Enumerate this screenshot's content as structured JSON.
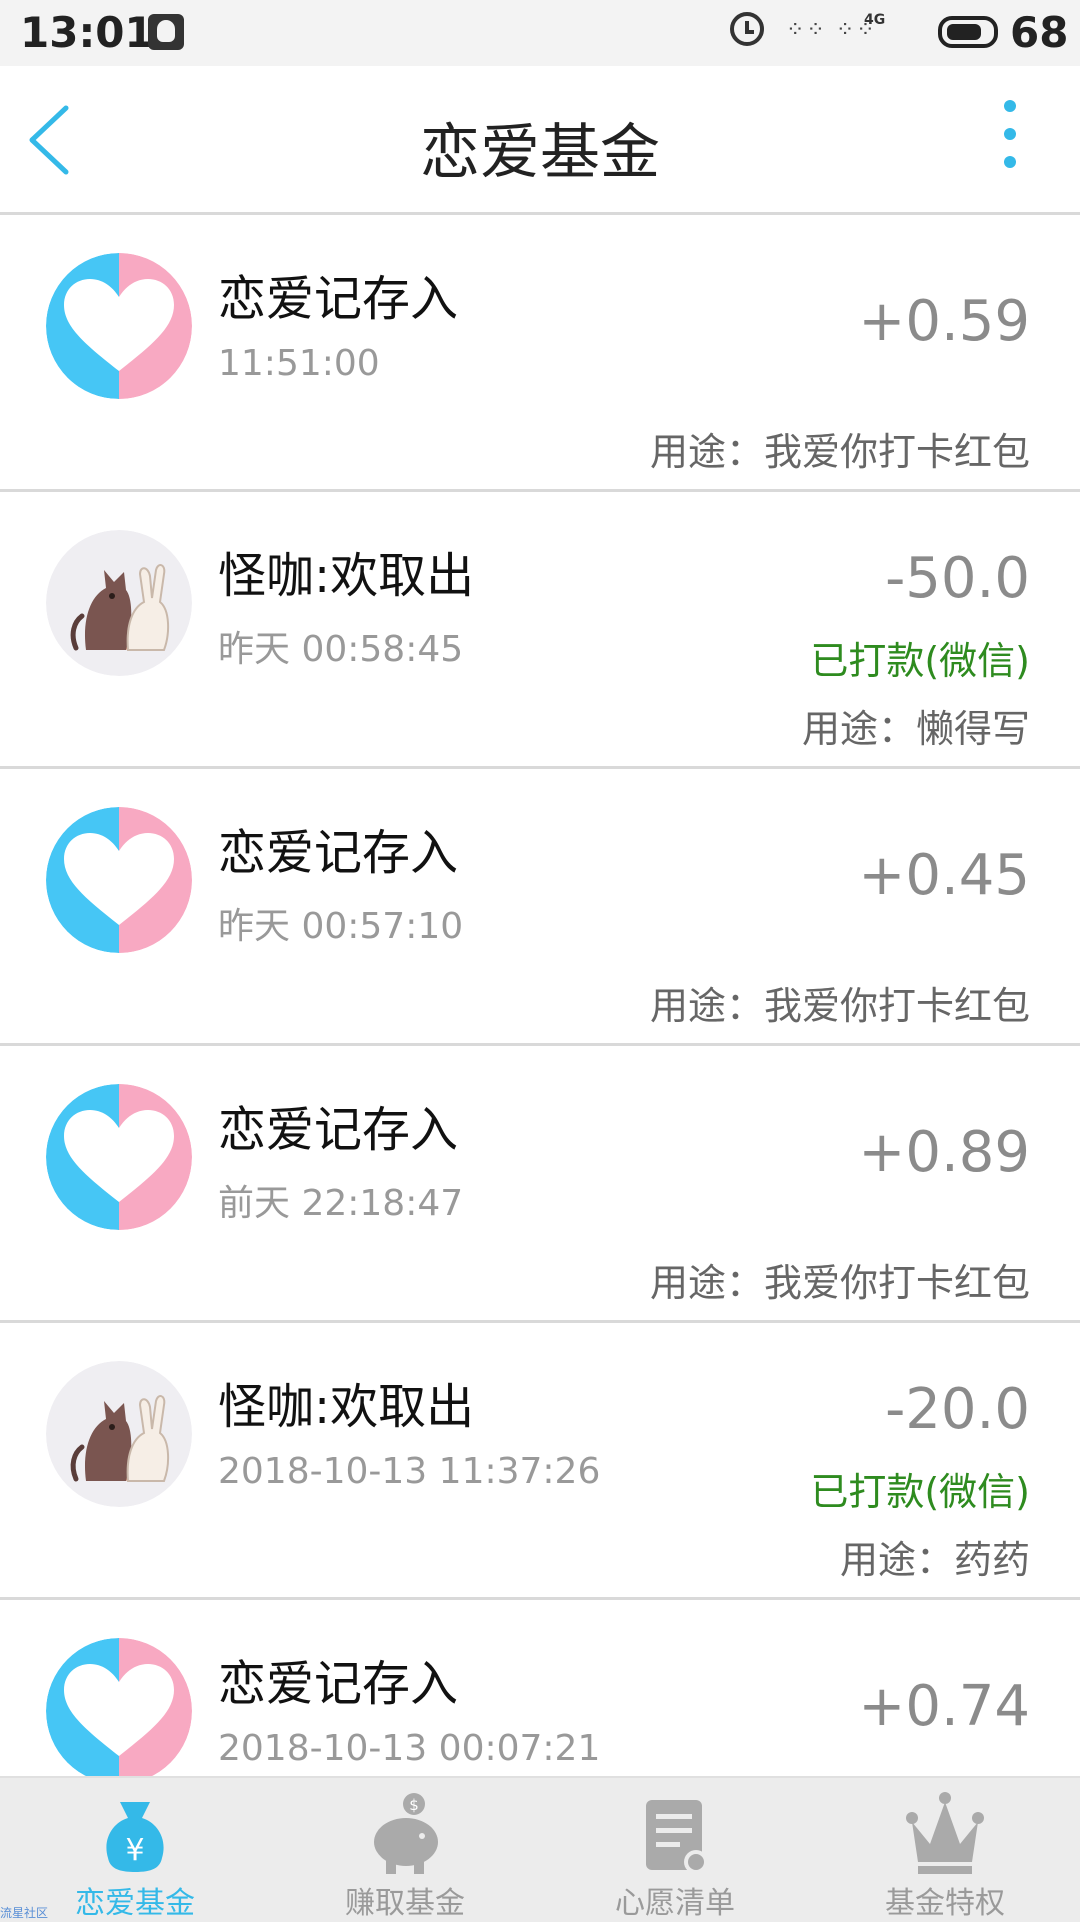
{
  "status_bar": {
    "time": "13:01",
    "network": "4G",
    "battery": "68"
  },
  "header": {
    "title": "恋爱基金"
  },
  "records": [
    {
      "avatar": "heart",
      "title": "恋爱记存入",
      "time": "11:51:00",
      "amount": "+0.59",
      "status": "",
      "purpose": "用途：我爱你打卡红包"
    },
    {
      "avatar": "cat-rabbit",
      "title": "怪咖:欢取出",
      "time": "昨天 00:58:45",
      "amount": "-50.0",
      "status": "已打款(微信)",
      "purpose": "用途：懒得写"
    },
    {
      "avatar": "heart",
      "title": "恋爱记存入",
      "time": "昨天 00:57:10",
      "amount": "+0.45",
      "status": "",
      "purpose": "用途：我爱你打卡红包"
    },
    {
      "avatar": "heart",
      "title": "恋爱记存入",
      "time": "前天 22:18:47",
      "amount": "+0.89",
      "status": "",
      "purpose": "用途：我爱你打卡红包"
    },
    {
      "avatar": "cat-rabbit",
      "title": "怪咖:欢取出",
      "time": "2018-10-13 11:37:26",
      "amount": "-20.0",
      "status": "已打款(微信)",
      "purpose": "用途：药药"
    },
    {
      "avatar": "heart",
      "title": "恋爱记存入",
      "time": "2018-10-13 00:07:21",
      "amount": "+0.74",
      "status": "",
      "purpose": ""
    }
  ],
  "bottom_nav": [
    {
      "label": "恋爱基金",
      "icon": "money-bag-icon",
      "active": true
    },
    {
      "label": "赚取基金",
      "icon": "piggy-bank-icon",
      "active": false
    },
    {
      "label": "心愿清单",
      "icon": "wishlist-icon",
      "active": false
    },
    {
      "label": "基金特权",
      "icon": "crown-icon",
      "active": false
    }
  ],
  "watermark": "流星社区",
  "colors": {
    "accent": "#34b9e8",
    "heart_blue": "#46c6f5",
    "heart_pink": "#f8a9c2",
    "paid_green": "#2e8b1f"
  }
}
